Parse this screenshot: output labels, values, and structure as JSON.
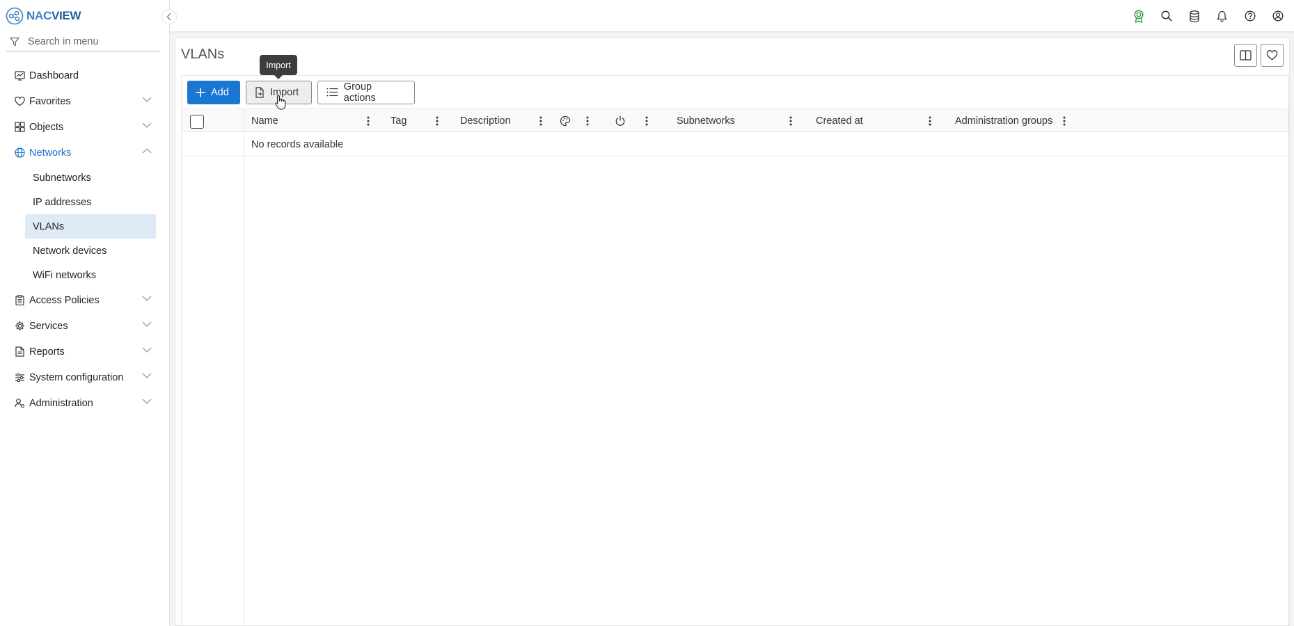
{
  "brand": {
    "part1": "NAC",
    "part2": "VIEW",
    "accent": "#1976d2"
  },
  "sidebar": {
    "search_placeholder": "Search in menu",
    "items": [
      {
        "label": "Dashboard",
        "icon": "dashboard-icon"
      },
      {
        "label": "Favorites",
        "icon": "heart-icon"
      },
      {
        "label": "Objects",
        "icon": "objects-icon"
      },
      {
        "label": "Networks",
        "icon": "globe-icon",
        "expanded": true
      },
      {
        "label": "Access Policies",
        "icon": "clipboard-icon"
      },
      {
        "label": "Services",
        "icon": "gear-icon"
      },
      {
        "label": "Reports",
        "icon": "report-icon"
      },
      {
        "label": "System configuration",
        "icon": "sliders-icon"
      },
      {
        "label": "Administration",
        "icon": "user-gear-icon"
      }
    ],
    "networks_children": [
      "Subnetworks",
      "IP addresses",
      "VLANs",
      "Network devices",
      "WiFi networks"
    ],
    "selected": "VLANs"
  },
  "topbar": {
    "icons": [
      "license-icon",
      "search-icon",
      "database-icon",
      "bell-icon",
      "help-icon",
      "user-icon"
    ]
  },
  "page": {
    "title": "VLANs"
  },
  "toolbar": {
    "add_label": "Add",
    "import_label": "Import",
    "group_actions_label": "Group actions"
  },
  "tooltip": {
    "text": "Import"
  },
  "table": {
    "columns": [
      "Name",
      "Tag",
      "Description",
      "color-icon",
      "power-icon",
      "Subnetworks",
      "Created at",
      "Administration groups"
    ],
    "empty_message": "No records available"
  }
}
